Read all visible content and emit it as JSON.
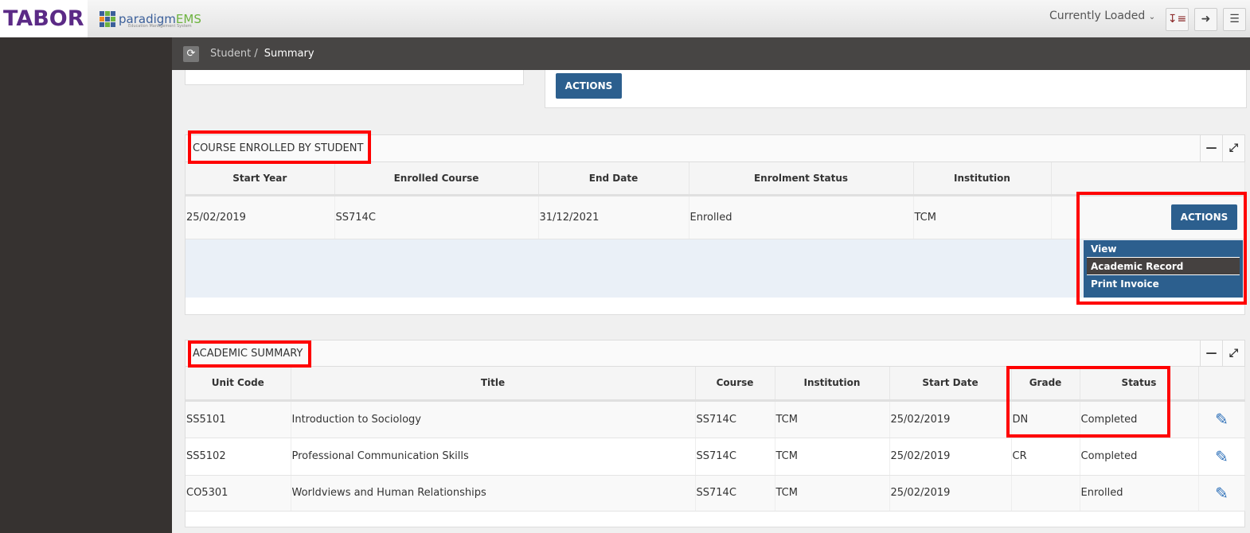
{
  "header": {
    "logo_tabor": "TABOR",
    "logo_pems": "paradigm",
    "logo_pems_accent": "EMS",
    "logo_pems_sub": "Education Management System",
    "currently_loaded": "Currently Loaded",
    "icons": [
      "sort-icon",
      "logout-icon",
      "menu-icon"
    ]
  },
  "breadcrumb": {
    "parent": "Student",
    "separator": "/",
    "current": "Summary"
  },
  "top_actions_label": "ACTIONS",
  "course_panel": {
    "title": "COURSE ENROLLED BY STUDENT",
    "columns": [
      "Start Year",
      "Enrolled Course",
      "End Date",
      "Enrolment Status",
      "Institution",
      ""
    ],
    "rows": [
      {
        "start_year": "25/02/2019",
        "course": "SS714C",
        "end_date": "31/12/2021",
        "status": "Enrolled",
        "institution": "TCM"
      }
    ],
    "actions_label": "ACTIONS",
    "menu": [
      "View",
      "Academic Record",
      "Print Invoice"
    ],
    "menu_highlighted": "Academic Record"
  },
  "academic_panel": {
    "title": "ACADEMIC SUMMARY",
    "columns": [
      "Unit Code",
      "Title",
      "Course",
      "Institution",
      "Start Date",
      "Grade",
      "Status",
      ""
    ],
    "rows": [
      {
        "unit": "SS5101",
        "title": "Introduction to Sociology",
        "course": "SS714C",
        "institution": "TCM",
        "start": "25/02/2019",
        "grade": "DN",
        "status": "Completed"
      },
      {
        "unit": "SS5102",
        "title": "Professional Communication Skills",
        "course": "SS714C",
        "institution": "TCM",
        "start": "25/02/2019",
        "grade": "CR",
        "status": "Completed"
      },
      {
        "unit": "CO5301",
        "title": "Worldviews and Human Relationships",
        "course": "SS714C",
        "institution": "TCM",
        "start": "25/02/2019",
        "grade": "",
        "status": "Enrolled"
      }
    ]
  },
  "colors": {
    "accent": "#2c5f8e",
    "highlight": "#ff0000",
    "sidebar": "#363230"
  }
}
